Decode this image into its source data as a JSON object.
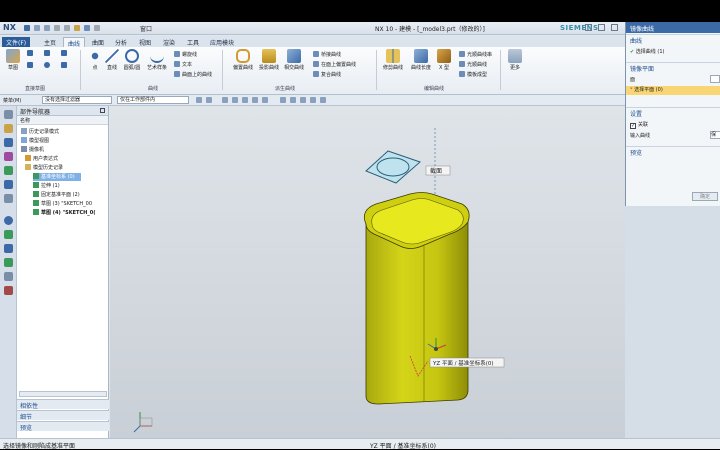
{
  "app": {
    "logo": "NX",
    "window_menu": "窗口",
    "title": "NX 10 - 建模 - [_model3.prt（修改的）]",
    "brand": "SIEMENS"
  },
  "menu": {
    "tabs": [
      "文件(F)",
      "主页",
      "曲线",
      "曲面",
      "分析",
      "视图",
      "渲染",
      "工具",
      "应用模块"
    ],
    "active": "曲线"
  },
  "ribbon": {
    "sketch_label": "草图",
    "direct_sketch_group": "直接草图",
    "point_label": "点",
    "line_label": "直线",
    "arc_label": "圆弧/圆",
    "artspline_label": "艺术样条",
    "helix": "螺旋线",
    "text": "文本",
    "curve_on_surface": "曲面上的曲线",
    "curve_group": "曲线",
    "bridge": "桥接曲线",
    "on_face_offset": "在面上偏置曲线",
    "composite": "复合曲线",
    "mirror": "镜像曲线",
    "offset": "偏置曲线",
    "projection": "投影曲线",
    "intersect": "相交曲线",
    "derived_group": "派生曲线",
    "trim_curve": "修剪曲线",
    "curve_length": "曲线长度",
    "x_type": "X 型",
    "smooth_spline": "光顺曲线串",
    "smooth_curve": "光顺曲线",
    "template": "模板成型",
    "edit_group": "编辑曲线",
    "more": "更多"
  },
  "filterbar": {
    "menu_label": "菜单(M)",
    "selection_filter": "没有选择过滤器",
    "scope": "仅在工作部件内"
  },
  "navigator": {
    "title": "部件导航器",
    "column_name": "名称",
    "nodes": [
      "历史记录模式",
      "模型视图",
      "摄像机",
      "用户表达式",
      "模型历史记录",
      "基准坐标系 (0)",
      "拉伸 (1)",
      "固定基准平面 (2)",
      "草图 (3) \"SKETCH_00",
      "草图 (4) \"SKETCH_0("
    ],
    "lower_panels": [
      "相依性",
      "细节",
      "预览"
    ]
  },
  "viewport": {
    "tooltip_top": "截面",
    "tooltip_mid": "YZ 平面 / 基准坐标系(0)",
    "model_color": "#d4d419"
  },
  "dialog": {
    "title": "镜像曲线",
    "section_curve": "曲线",
    "select_curve": "选择曲线 (1)",
    "section_mirror_plane": "镜像平面",
    "plane_label": "面",
    "select_plane": "选择平面 (0)",
    "section_settings": "设置",
    "associative": "关联",
    "input_curve": "输入曲线",
    "input_value": "保",
    "section_preview": "预览",
    "ok": "确定"
  },
  "status": {
    "left": "选择镜像和刚陷成基准平面",
    "center": "YZ 平面 / 基准坐标系(0)"
  }
}
